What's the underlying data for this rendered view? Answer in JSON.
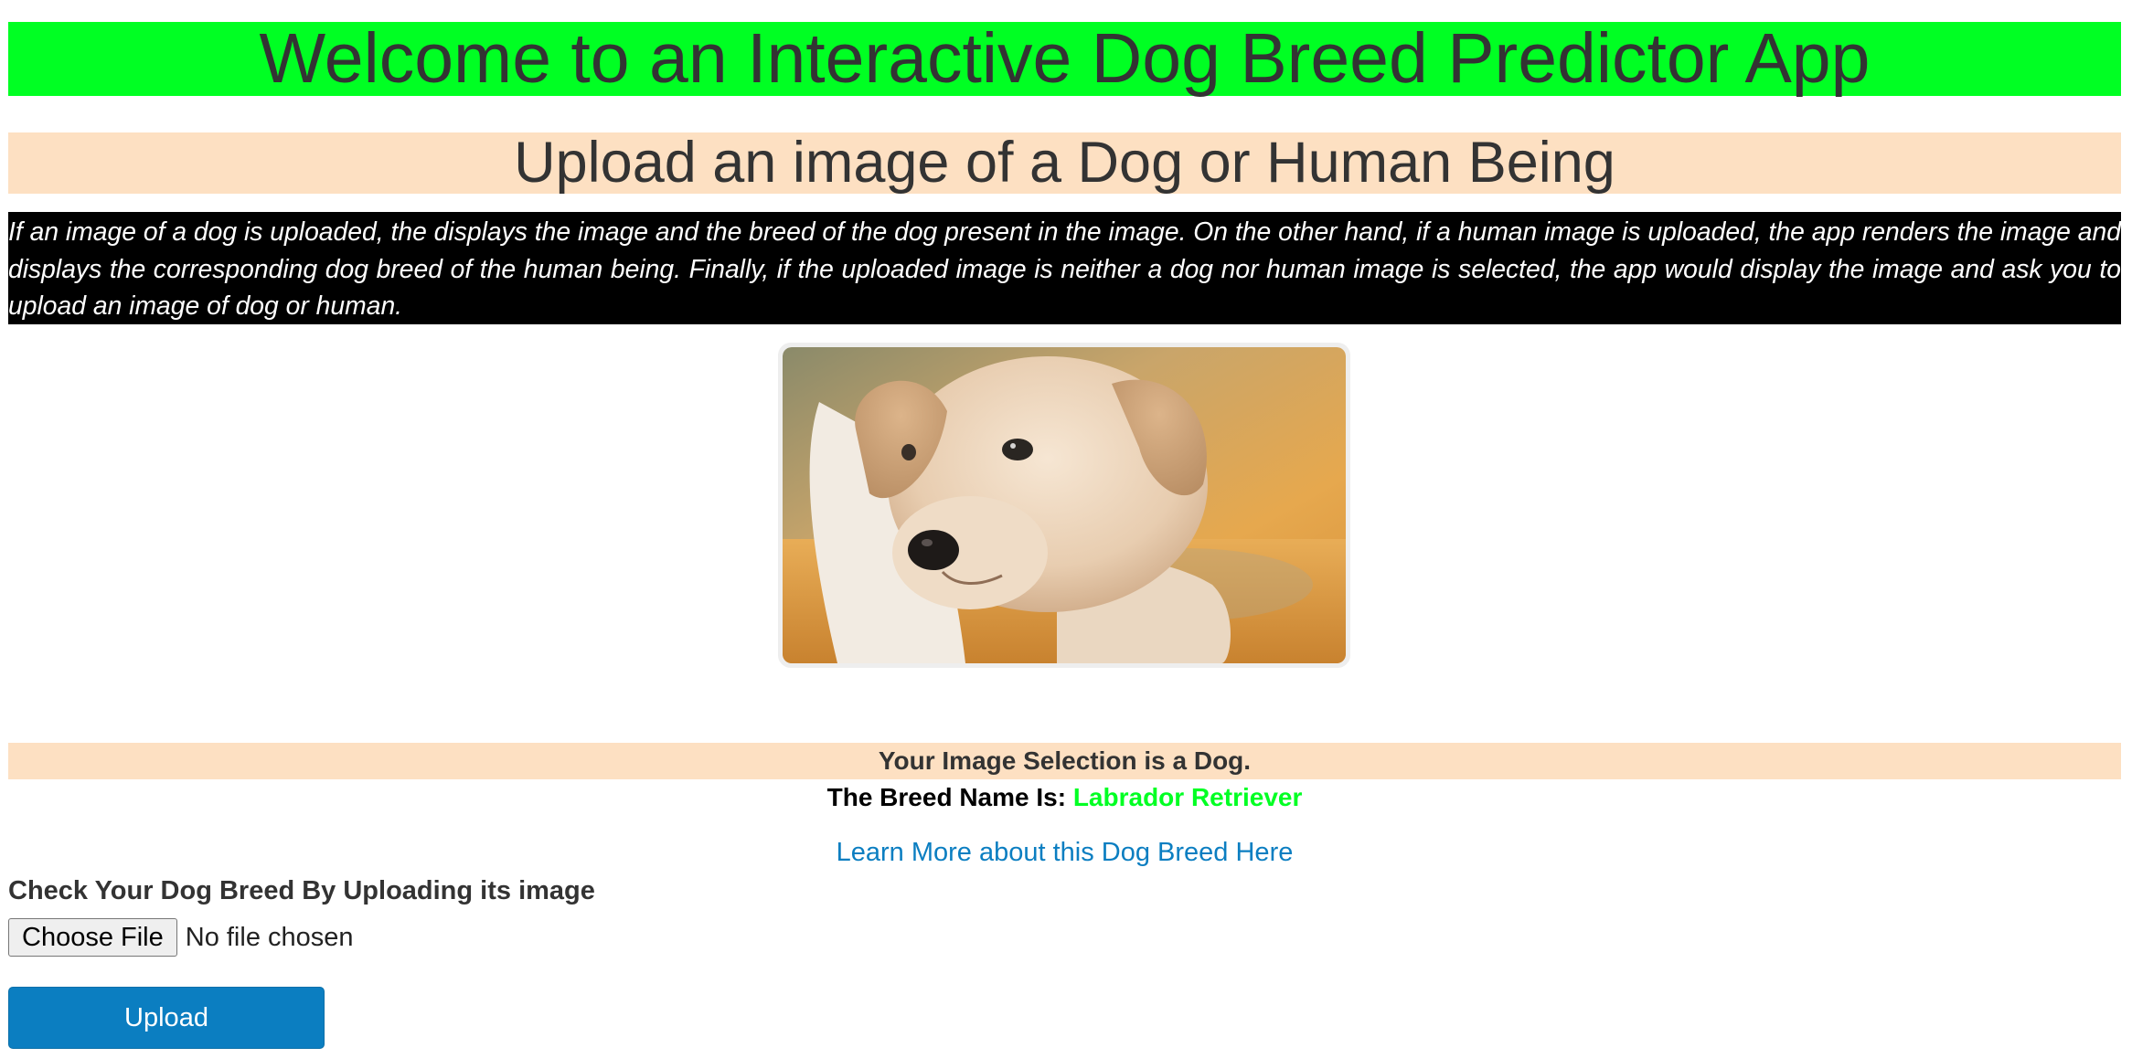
{
  "header": {
    "title": "Welcome to an Interactive Dog Breed Predictor App",
    "subtitle": "Upload an image of a Dog or Human Being",
    "description": "If an image of a dog is uploaded, the displays the image and the breed of the dog present in the image. On the other hand, if a human image is uploaded, the app renders the image and displays the corresponding dog breed of the human being. Finally, if the uploaded image is neither a dog nor human image is selected, the app would display the image and ask you to upload an image of dog or human."
  },
  "result": {
    "selection_text": "Your Image Selection is a Dog.",
    "breed_label": "The Breed Name Is:",
    "breed_value": "Labrador Retriever",
    "learn_more_link": "Learn More about this Dog Breed Here"
  },
  "upload_form": {
    "label": "Check Your Dog Breed By Uploading its image",
    "choose_file_button": "Choose File",
    "file_status": "No file chosen",
    "upload_button": "Upload"
  },
  "colors": {
    "title_banner": "#00ff23",
    "subtitle_banner": "#fde0c2",
    "description_bg": "#000000",
    "breed_value": "#00ff23",
    "link": "#0b7ec1",
    "upload_button": "#0b7ec1"
  }
}
